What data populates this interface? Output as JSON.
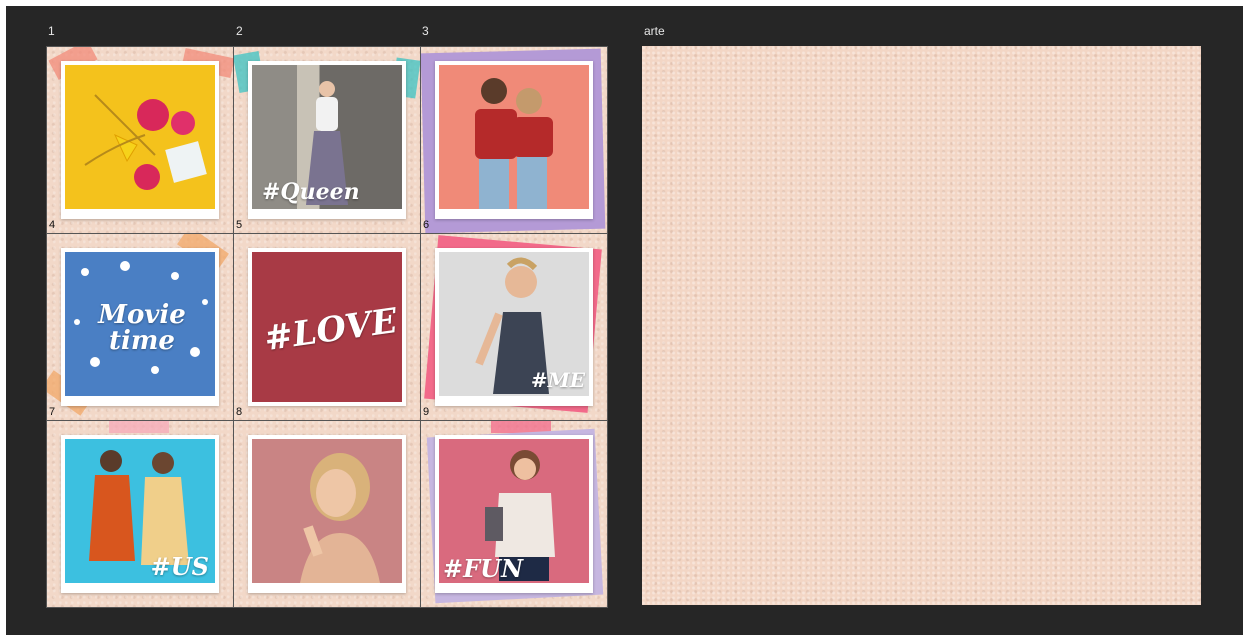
{
  "artboards": {
    "labels": [
      "1",
      "2",
      "3",
      "arte"
    ]
  },
  "cells": [
    {
      "number": "4",
      "overlay_text": "",
      "photo_bg": "#f4c21c",
      "tape_color": "#f28b7a"
    },
    {
      "number": "5",
      "overlay_text": "#Queen",
      "photo_bg": "#9c9a95",
      "tape_color": "#3cc3c3"
    },
    {
      "number": "6",
      "overlay_text": "",
      "photo_bg": "#f08a78",
      "tape_color": "#b49ad6"
    },
    {
      "number": "7",
      "overlay_text": "Movie time",
      "photo_bg": "#4a7fc4",
      "tape_color": "#f2a868"
    },
    {
      "number": "8",
      "overlay_text": "#LOVE",
      "photo_bg": "#a83a45",
      "tape_color": "#f2a868"
    },
    {
      "number": "9",
      "overlay_text": "#ME",
      "photo_bg": "#dcdcdc",
      "tape_color": "#f26a8a"
    },
    {
      "number": "",
      "overlay_text": "#US",
      "photo_bg": "#3cc0e0",
      "tape_color": "#f5a9b8"
    },
    {
      "number": "",
      "overlay_text": "",
      "photo_bg": "#c98484",
      "tape_color": "#f5a9b8"
    },
    {
      "number": "",
      "overlay_text": "#FUN",
      "photo_bg": "#d96a7e",
      "tape_color": "#f26a8a"
    }
  ],
  "colors": {
    "workspace": "#262626",
    "texture": "#f2d8c8",
    "gridline": "#555555"
  }
}
